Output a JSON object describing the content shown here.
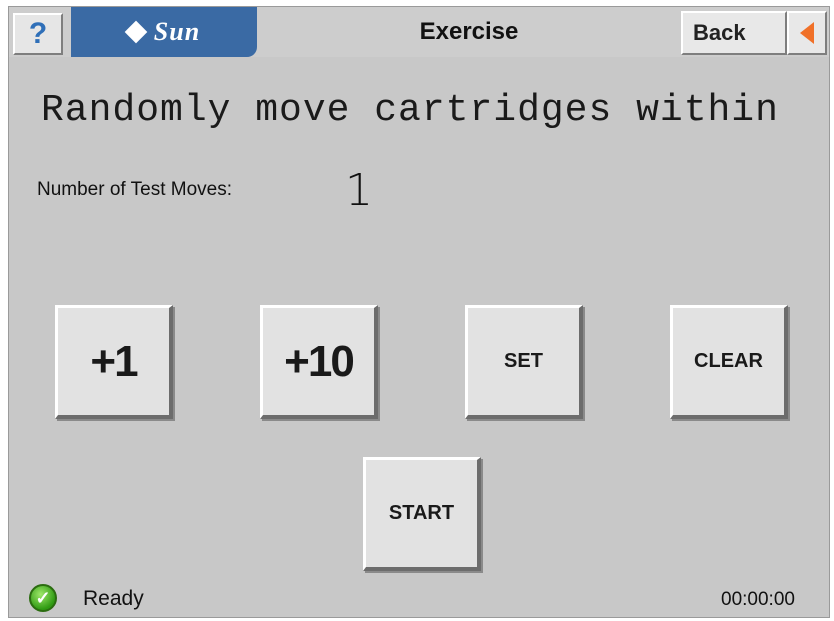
{
  "header": {
    "help_label": "?",
    "logo_text": "Sun",
    "title": "Exercise",
    "back_label": "Back"
  },
  "main": {
    "headline": "Randomly move cartridges within",
    "moves_label": "Number of Test Moves:",
    "moves_value": "1",
    "buttons": {
      "plus1": "+1",
      "plus10": "+10",
      "set": "SET",
      "clear": "CLEAR",
      "start": "START"
    }
  },
  "status": {
    "text": "Ready",
    "time": "00:00:00",
    "icon": "check-circle-icon"
  },
  "colors": {
    "background": "#c8c8c8",
    "logo_blue": "#3a6aa4",
    "back_arrow": "#f07028",
    "status_green": "#2f9a12"
  }
}
